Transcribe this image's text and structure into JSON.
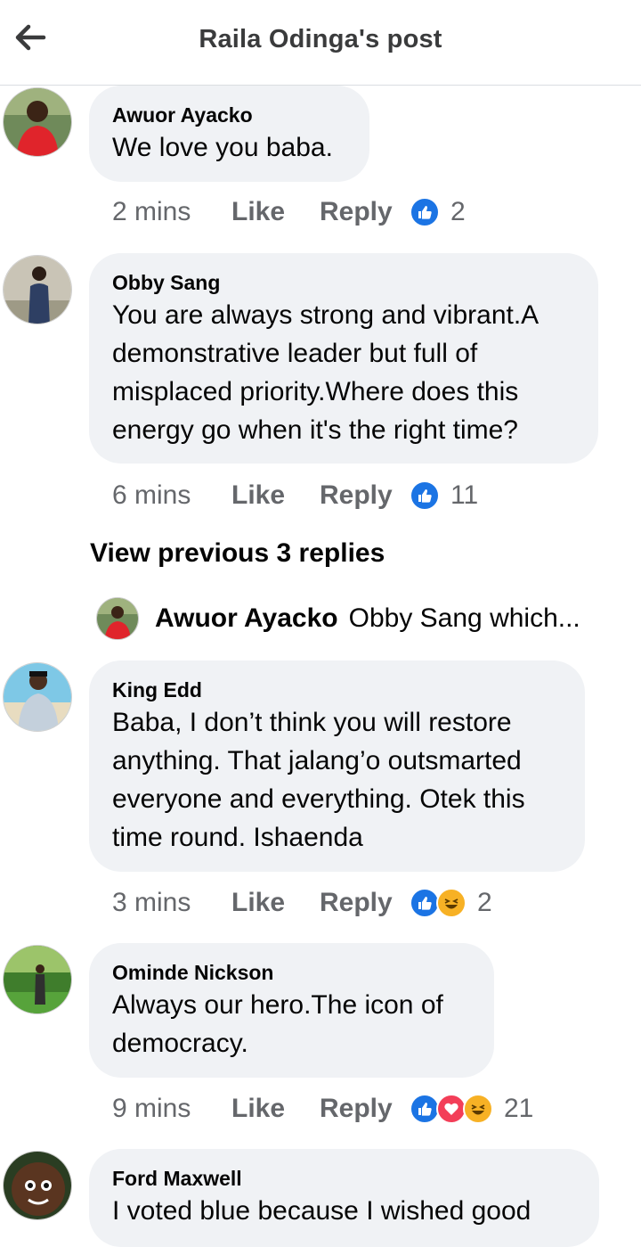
{
  "header": {
    "title": "Raila Odinga's post",
    "back_icon": "arrow-left-icon"
  },
  "comments": [
    {
      "author": "Awuor Ayacko",
      "text": "We love you baba.",
      "time": "2 mins",
      "like_label": "Like",
      "reply_label": "Reply",
      "reactions": [
        "like"
      ],
      "reaction_count": "2"
    },
    {
      "author": "Obby Sang",
      "text": "You are always strong and vibrant.A demonstrative leader but full of misplaced priority.Where does this energy go when it's the right time?",
      "time": "6 mins",
      "like_label": "Like",
      "reply_label": "Reply",
      "reactions": [
        "like"
      ],
      "reaction_count": "11"
    },
    {
      "author": "King Edd",
      "text": "Baba, I don’t think you will restore anything. That jalang’o outsmarted everyone and everything. Otek this time round. Ishaenda",
      "time": "3 mins",
      "like_label": "Like",
      "reply_label": "Reply",
      "reactions": [
        "like",
        "haha"
      ],
      "reaction_count": "2"
    },
    {
      "author": "Ominde Nickson",
      "text": "Always our hero.The icon of democracy.",
      "time": "9 mins",
      "like_label": "Like",
      "reply_label": "Reply",
      "reactions": [
        "like",
        "love",
        "haha"
      ],
      "reaction_count": "21"
    },
    {
      "author": "Ford Maxwell",
      "text": "I voted blue because I wished good"
    }
  ],
  "view_previous": "View previous 3 replies",
  "reply_preview": {
    "author": "Awuor Ayacko",
    "text": "Obby Sang which..."
  },
  "colors": {
    "bubble": "#f0f2f5",
    "like_blue": "#1b74e4",
    "love_red": "#f33e58",
    "haha_yellow": "#f7b125",
    "meta_gray": "#65676b"
  }
}
